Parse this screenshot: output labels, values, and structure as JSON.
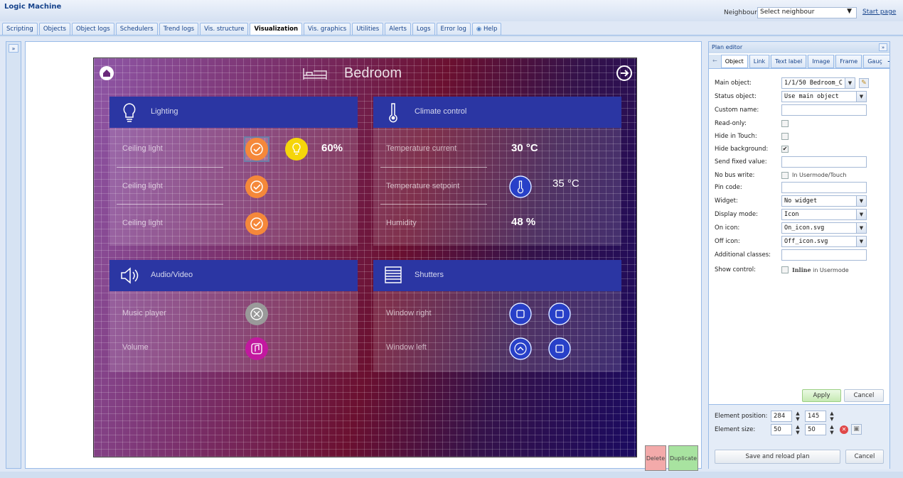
{
  "app": {
    "title": "Logic Machine"
  },
  "header": {
    "neighbours_label": "Neighbours:",
    "neighbours_value": "Select neighbour",
    "start_page": "Start page"
  },
  "tabs": [
    {
      "label": "Scripting"
    },
    {
      "label": "Objects"
    },
    {
      "label": "Object logs"
    },
    {
      "label": "Schedulers"
    },
    {
      "label": "Trend logs"
    },
    {
      "label": "Vis. structure"
    },
    {
      "label": "Visualization",
      "active": true
    },
    {
      "label": "Vis. graphics"
    },
    {
      "label": "Utilities"
    },
    {
      "label": "Alerts"
    },
    {
      "label": "Logs"
    },
    {
      "label": "Error log"
    },
    {
      "label": "Help"
    }
  ],
  "plan": {
    "title": "Bedroom",
    "colors": {
      "header_blue": "#2b36a3",
      "orange": "#f5883a",
      "yellow": "#f5d50a",
      "grey": "#9a9a9a",
      "magenta": "#c2189f",
      "blue": "#2840c8"
    },
    "lighting": {
      "title": "Lighting",
      "rows": [
        {
          "label": "Ceiling light"
        },
        {
          "label": "Ceiling light"
        },
        {
          "label": "Ceiling light"
        }
      ],
      "value": "60%"
    },
    "climate": {
      "title": "Climate control",
      "rows": [
        {
          "label": "Temperature current",
          "value": "30 °C"
        },
        {
          "label": "Temperature setpoint",
          "value": "35 °C"
        },
        {
          "label": "Humidity",
          "value": "48 %"
        }
      ]
    },
    "audio": {
      "title": "Audio/Video",
      "rows": [
        {
          "label": "Music player"
        },
        {
          "label": "Volume"
        }
      ]
    },
    "shutters": {
      "title": "Shutters",
      "rows": [
        {
          "label": "Window right"
        },
        {
          "label": "Window left"
        }
      ]
    },
    "delete_label": "Delete",
    "duplicate_label": "Duplicate"
  },
  "plan_editor": {
    "title": "Plan editor",
    "tabs": [
      "Object",
      "Link",
      "Text label",
      "Image",
      "Frame",
      "Gauç"
    ],
    "fields": {
      "main_object": {
        "label": "Main object:",
        "value": "1/1/50 Bedroom_C"
      },
      "status_object": {
        "label": "Status object:",
        "value": "Use main object"
      },
      "custom_name": {
        "label": "Custom name:",
        "value": ""
      },
      "read_only": {
        "label": "Read-only:",
        "checked": false
      },
      "hide_touch": {
        "label": "Hide in Touch:",
        "checked": false
      },
      "hide_background": {
        "label": "Hide background:",
        "checked": true
      },
      "send_fixed": {
        "label": "Send fixed value:",
        "value": ""
      },
      "no_bus_write": {
        "label": "No bus write:",
        "checked": false,
        "note": "In Usermode/Touch"
      },
      "pin_code": {
        "label": "Pin code:",
        "value": ""
      },
      "widget": {
        "label": "Widget:",
        "value": "No widget"
      },
      "display_mode": {
        "label": "Display mode:",
        "value": "Icon"
      },
      "on_icon": {
        "label": "On icon:",
        "value": "On_icon.svg"
      },
      "off_icon": {
        "label": "Off icon:",
        "value": "Off_icon.svg"
      },
      "additional_classes": {
        "label": "Additional classes:",
        "value": ""
      },
      "show_control": {
        "label": "Show control:",
        "checked": false,
        "note_bold": "Inline",
        "note": "in Usermode"
      }
    },
    "apply_label": "Apply",
    "cancel_label": "Cancel",
    "element_position": {
      "label": "Element position:",
      "x": "284",
      "y": "145"
    },
    "element_size": {
      "label": "Element size:",
      "w": "50",
      "h": "50"
    },
    "save_reload_label": "Save and reload plan",
    "cancel2_label": "Cancel"
  }
}
